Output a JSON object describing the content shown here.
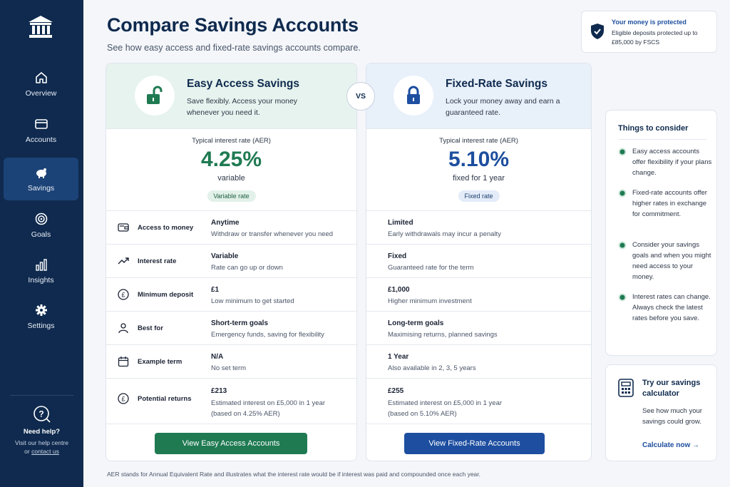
{
  "sidebar": {
    "logo_icon": "bank-icon",
    "items": [
      {
        "label": "Overview",
        "icon": "home-icon"
      },
      {
        "label": "Accounts",
        "icon": "card-icon"
      },
      {
        "label": "Savings",
        "icon": "piggy-bank-icon",
        "active": true
      },
      {
        "label": "Goals",
        "icon": "target-icon"
      },
      {
        "label": "Insights",
        "icon": "bar-chart-icon"
      },
      {
        "label": "Settings",
        "icon": "gear-icon"
      }
    ],
    "help": {
      "title": "Need help?",
      "text_line": "Visit our help centre",
      "or_text": "or",
      "link": "contact us"
    }
  },
  "header": {
    "title": "Compare Savings Accounts",
    "subtitle": "See how easy access and fixed-rate savings accounts compare."
  },
  "protection": {
    "title": "Your money is protected",
    "text": "Eligible deposits protected up to £85,000 by FSCS"
  },
  "vs_label": "VS",
  "easy": {
    "title": "Easy Access Savings",
    "description": "Save flexibly. Access your money whenever you need it.",
    "rate_label": "Typical interest rate (AER)",
    "rate": "4.25%",
    "rate_type": "variable",
    "pill": "Variable rate",
    "rows": [
      {
        "main": "Anytime",
        "sub": "Withdraw or transfer whenever you need"
      },
      {
        "main": "Variable",
        "sub": "Rate can go up or down"
      },
      {
        "main": "£1",
        "sub": "Low minimum to get started"
      },
      {
        "main": "Short-term goals",
        "sub": "Emergency funds, saving for flexibility"
      },
      {
        "main": "N/A",
        "sub": "No set term"
      },
      {
        "main": "£213",
        "sub": "Estimated interest on £5,000 in 1 year",
        "sub2": "(based on 4.25% AER)"
      }
    ],
    "cta": "View Easy Access Accounts"
  },
  "fixed": {
    "title": "Fixed-Rate Savings",
    "description": "Lock your money away and earn a guaranteed rate.",
    "rate_label": "Typical interest rate (AER)",
    "rate": "5.10%",
    "rate_type": "fixed for 1 year",
    "pill": "Fixed rate",
    "rows": [
      {
        "main": "Limited",
        "sub": "Early withdrawals may incur a penalty"
      },
      {
        "main": "Fixed",
        "sub": "Guaranteed rate for the term"
      },
      {
        "main": "£1,000",
        "sub": "Higher minimum investment"
      },
      {
        "main": "Long-term goals",
        "sub": "Maximising returns, planned savings"
      },
      {
        "main": "1 Year",
        "sub": "Also available in 2, 3, 5 years"
      },
      {
        "main": "£255",
        "sub": "Estimated interest on £5,000 in 1 year",
        "sub2": "(based on 5.10% AER)"
      }
    ],
    "cta": "View Fixed-Rate Accounts"
  },
  "row_labels": [
    {
      "label": "Access to money",
      "icon": "wallet-icon"
    },
    {
      "label": "Interest rate",
      "icon": "trend-up-icon"
    },
    {
      "label": "Minimum deposit",
      "icon": "pound-coin-icon"
    },
    {
      "label": "Best for",
      "icon": "person-icon"
    },
    {
      "label": "Example term",
      "icon": "calendar-icon"
    },
    {
      "label": "Potential returns",
      "icon": "pound-coin-icon"
    }
  ],
  "consider": {
    "title": "Things to consider",
    "items": [
      "Easy access accounts offer flexibility if your plans change.",
      "Fixed-rate accounts offer higher rates in exchange for commitment.",
      "Consider your savings goals and when you might need access to your money.",
      "Interest rates can change. Always check the latest rates before you save."
    ]
  },
  "calculator": {
    "title": "Try our savings calculator",
    "text": "See how much your savings could grow.",
    "link": "Calculate now →"
  },
  "footnote": "AER stands for Annual Equivalent Rate and illustrates what the interest rate would be if interest was paid and compounded once each year.",
  "colors": {
    "sidebar": "#0f2a4e",
    "sidebar_active": "#1c4377",
    "easy_accent": "#1f7a52",
    "fixed_accent": "#1d4ea0"
  }
}
